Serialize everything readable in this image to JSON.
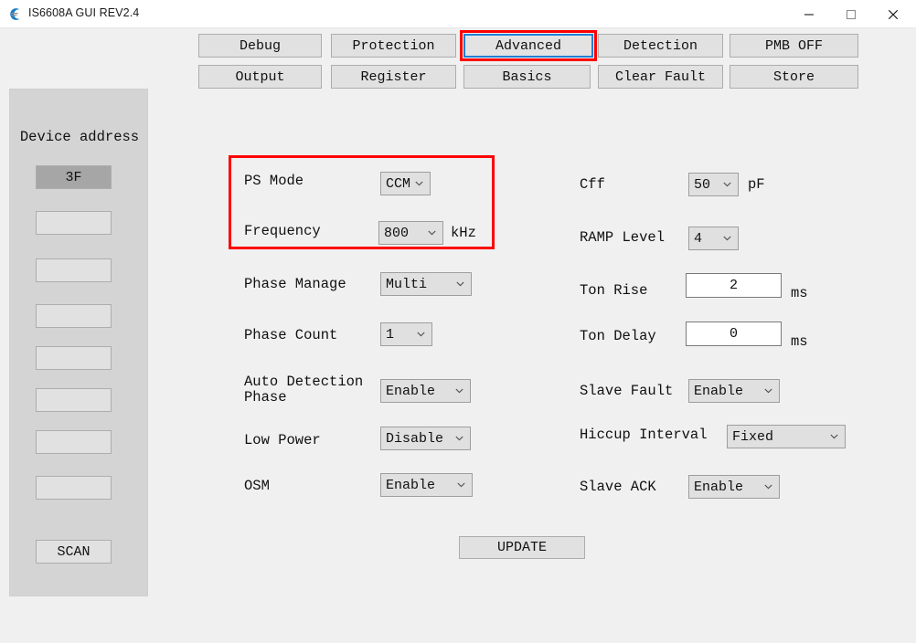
{
  "window": {
    "title": "IS6608A GUI REV2.4",
    "icon": "app-swoosh-icon",
    "controls": {
      "minimize": "minimize-icon",
      "maximize": "maximize-icon",
      "close": "close-icon"
    }
  },
  "tabs": {
    "row1": [
      {
        "label": "Debug",
        "focused": false
      },
      {
        "label": "Protection",
        "focused": false
      },
      {
        "label": "Advanced",
        "focused": true
      },
      {
        "label": "Detection",
        "focused": false
      },
      {
        "label": "PMB OFF",
        "focused": false
      }
    ],
    "row2": [
      {
        "label": "Output",
        "focused": false
      },
      {
        "label": "Register",
        "focused": false
      },
      {
        "label": "Basics",
        "focused": false
      },
      {
        "label": "Clear Fault",
        "focused": false
      },
      {
        "label": "Store",
        "focused": false
      }
    ]
  },
  "sidebar": {
    "title": "Device address",
    "addresses": [
      {
        "label": "3F",
        "selected": true
      },
      {
        "label": "",
        "selected": false
      },
      {
        "label": "",
        "selected": false
      },
      {
        "label": "",
        "selected": false
      },
      {
        "label": "",
        "selected": false
      },
      {
        "label": "",
        "selected": false
      },
      {
        "label": "",
        "selected": false
      },
      {
        "label": "",
        "selected": false
      }
    ],
    "scan_label": "SCAN"
  },
  "form": {
    "left": [
      {
        "label": "PS Mode",
        "value": "CCM",
        "unit": "",
        "type": "select"
      },
      {
        "label": "Frequency",
        "value": "800",
        "unit": "kHz",
        "type": "select"
      },
      {
        "label": "Phase Manage",
        "value": "Multi",
        "unit": "",
        "type": "select"
      },
      {
        "label": "Phase Count",
        "value": "1",
        "unit": "",
        "type": "select"
      },
      {
        "label": "Auto Detection\nPhase",
        "value": "Enable",
        "unit": "",
        "type": "select"
      },
      {
        "label": "Low Power",
        "value": "Disable",
        "unit": "",
        "type": "select"
      },
      {
        "label": "OSM",
        "value": "Enable",
        "unit": "",
        "type": "select"
      }
    ],
    "right": [
      {
        "label": "Cff",
        "value": "50",
        "unit": "pF",
        "type": "select"
      },
      {
        "label": "RAMP Level",
        "value": "4",
        "unit": "",
        "type": "select"
      },
      {
        "label": "Ton Rise",
        "value": "2",
        "unit": "ms",
        "type": "text"
      },
      {
        "label": "Ton Delay",
        "value": "0",
        "unit": "ms",
        "type": "text"
      },
      {
        "label": "Slave Fault",
        "value": "Enable",
        "unit": "",
        "type": "select"
      },
      {
        "label": "Hiccup Interval",
        "value": "Fixed",
        "unit": "",
        "type": "select"
      },
      {
        "label": "Slave ACK",
        "value": "Enable",
        "unit": "",
        "type": "select"
      }
    ]
  },
  "update_button": {
    "label": "UPDATE"
  },
  "annotations": {
    "tab_highlight_color": "#ff0000",
    "field_highlight_color": "#ff0000",
    "focus_border_color": "#1f7fd4"
  }
}
